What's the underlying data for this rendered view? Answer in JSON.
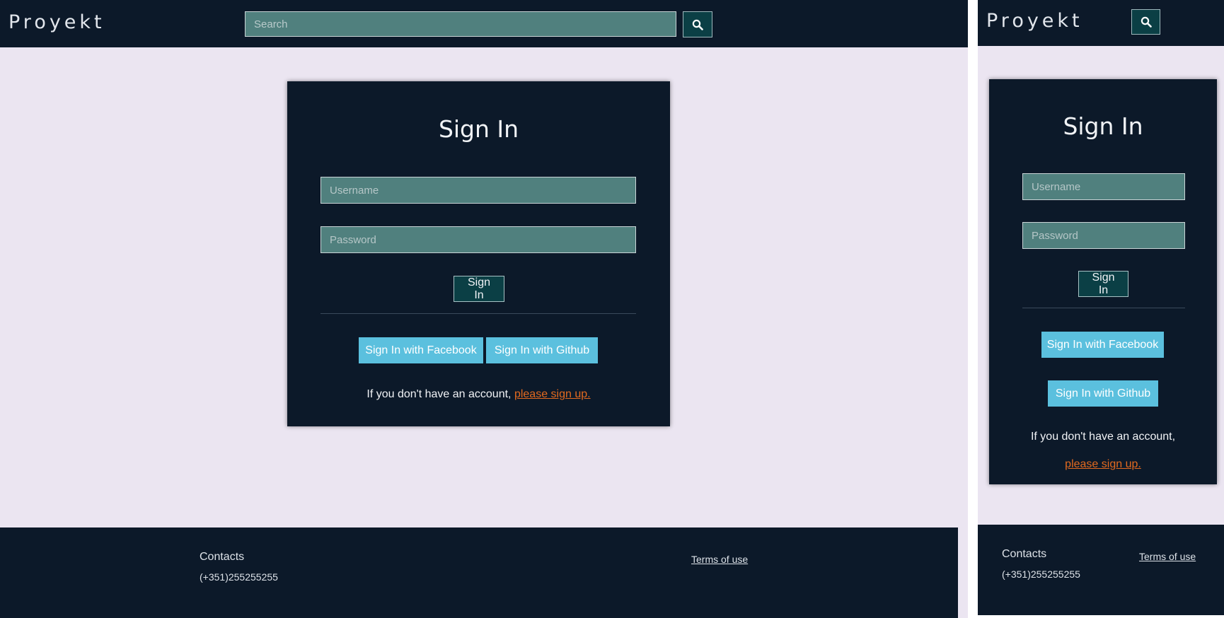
{
  "brand": "Proyekt",
  "search": {
    "placeholder": "Search"
  },
  "card": {
    "title": "Sign In",
    "username_placeholder": "Username",
    "password_placeholder": "Password",
    "signin_label": "Sign In",
    "facebook_label": "Sign In with Facebook",
    "github_label": "Sign In with Github",
    "no_account_text": "If you don't have an account,",
    "signup_link": "please sign up."
  },
  "footer": {
    "contacts_label": "Contacts",
    "phone": "(+351)255255255",
    "terms_label": "Terms of use"
  },
  "colors": {
    "navy": "#0c1929",
    "page_bg": "#ebe5f1",
    "input_teal": "#50807e",
    "button_dark_teal": "#0b3f45",
    "social_blue": "#5bc0de",
    "link_orange": "#e36a1f"
  },
  "icons": {
    "search": "search-icon"
  }
}
